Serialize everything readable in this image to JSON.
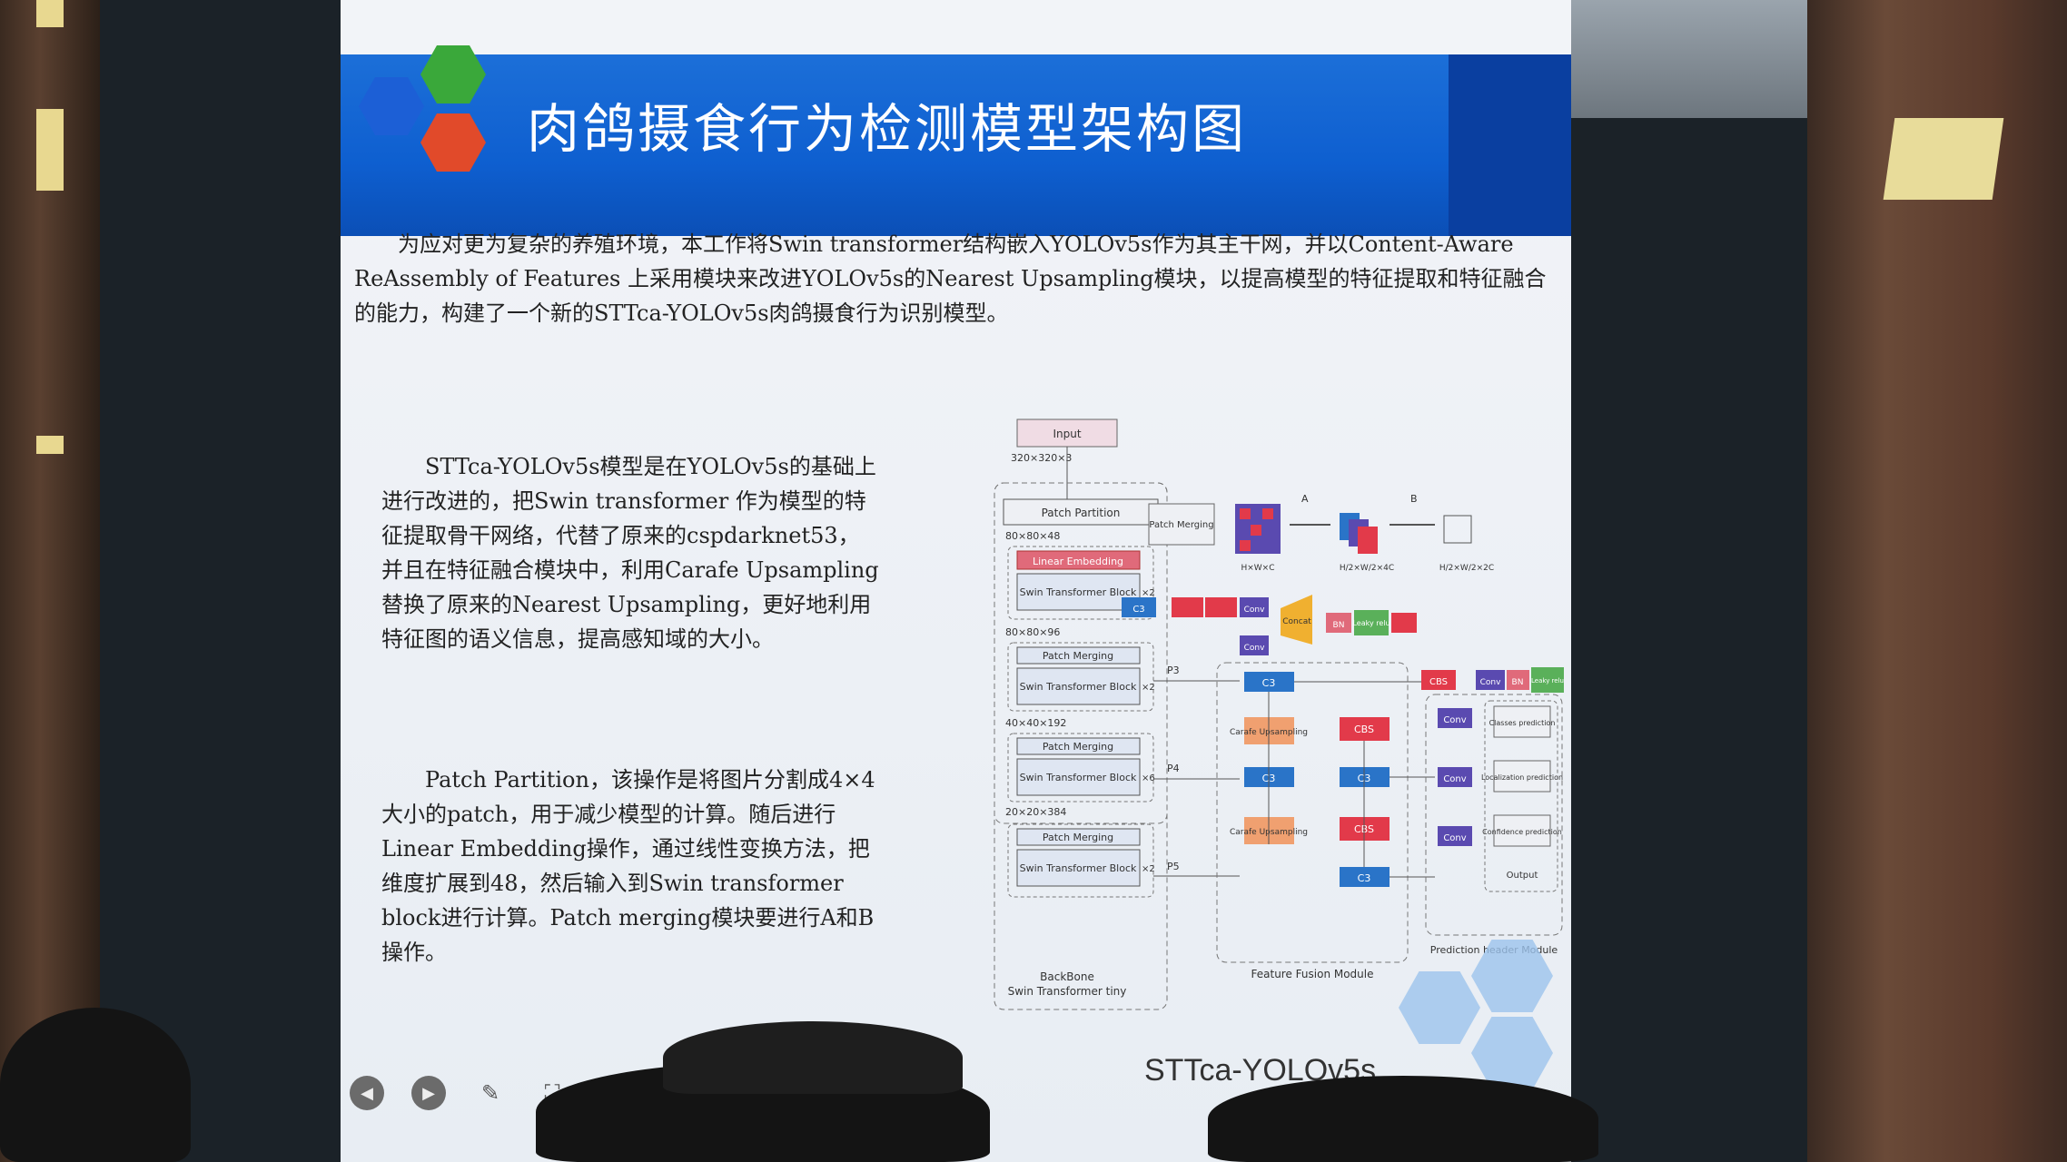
{
  "slide": {
    "title": "肉鸽摄食行为检测模型架构图",
    "intro": "为应对更为复杂的养殖环境，本工作将Swin transformer结构嵌入YOLOv5s作为其主干网，并以Content-Aware ReAssembly of Features 上采用模块来改进YOLOv5s的Nearest Upsampling模块，以提高模型的特征提取和特征融合的能力，构建了一个新的STTca-YOLOv5s肉鸽摄食行为识别模型。",
    "para1": "STTca-YOLOv5s模型是在YOLOv5s的基础上进行改进的，把Swin transformer 作为模型的特征提取骨干网络，代替了原来的cspdarknet53，并且在特征融合模块中，利用Carafe Upsampling替换了原来的Nearest Upsampling，更好地利用特征图的语义信息，提高感知域的大小。",
    "para2": "Patch Partition，该操作是将图片分割成4×4大小的patch，用于减少模型的计算。随后进行Linear Embedding操作，通过线性变换方法，把维度扩展到48，然后输入到Swin transformer block进行计算。Patch merging模块要进行A和B操作。",
    "caption": "STTca-YOLOv5s"
  },
  "diagram": {
    "input": "Input",
    "input_dim": "320×320×3",
    "patch_partition": "Patch Partition",
    "dim1": "80×80×48",
    "linear_embedding": "Linear Embedding",
    "swin_block": "Swin Transformer Block",
    "x2": "×2",
    "x6": "×6",
    "dim2": "80×80×96",
    "patch_merging": "Patch Merging",
    "dim3": "40×40×192",
    "dim4": "20×20×384",
    "backbone_label1": "BackBone",
    "backbone_label2": "Swin Transformer tiny",
    "p3": "P3",
    "p4": "P4",
    "p5": "P5",
    "c3": "C3",
    "carafe": "Carafe Upsampling",
    "cbs": "CBS",
    "conv": "Conv",
    "concat": "Concat",
    "bn": "BN",
    "leaky_relu": "Leaky relu",
    "feature_fusion": "Feature Fusion Module",
    "class_pred": "Classes prediction",
    "loc_pred": "Localization prediction",
    "conf_pred": "Confidence prediction",
    "output": "Output",
    "prediction_header": "Prediction header Module",
    "pm_box": "Patch Merging",
    "a": "A",
    "b": "B",
    "hwc": "H×W×C",
    "h2w2c": "H/2×W/2×4C",
    "h2w2c2": "H/2×W/2×2C"
  },
  "toolbar": {
    "prev": "◀",
    "next": "▶",
    "pen": "✎",
    "zoom": "⛶",
    "screen": "▣"
  }
}
